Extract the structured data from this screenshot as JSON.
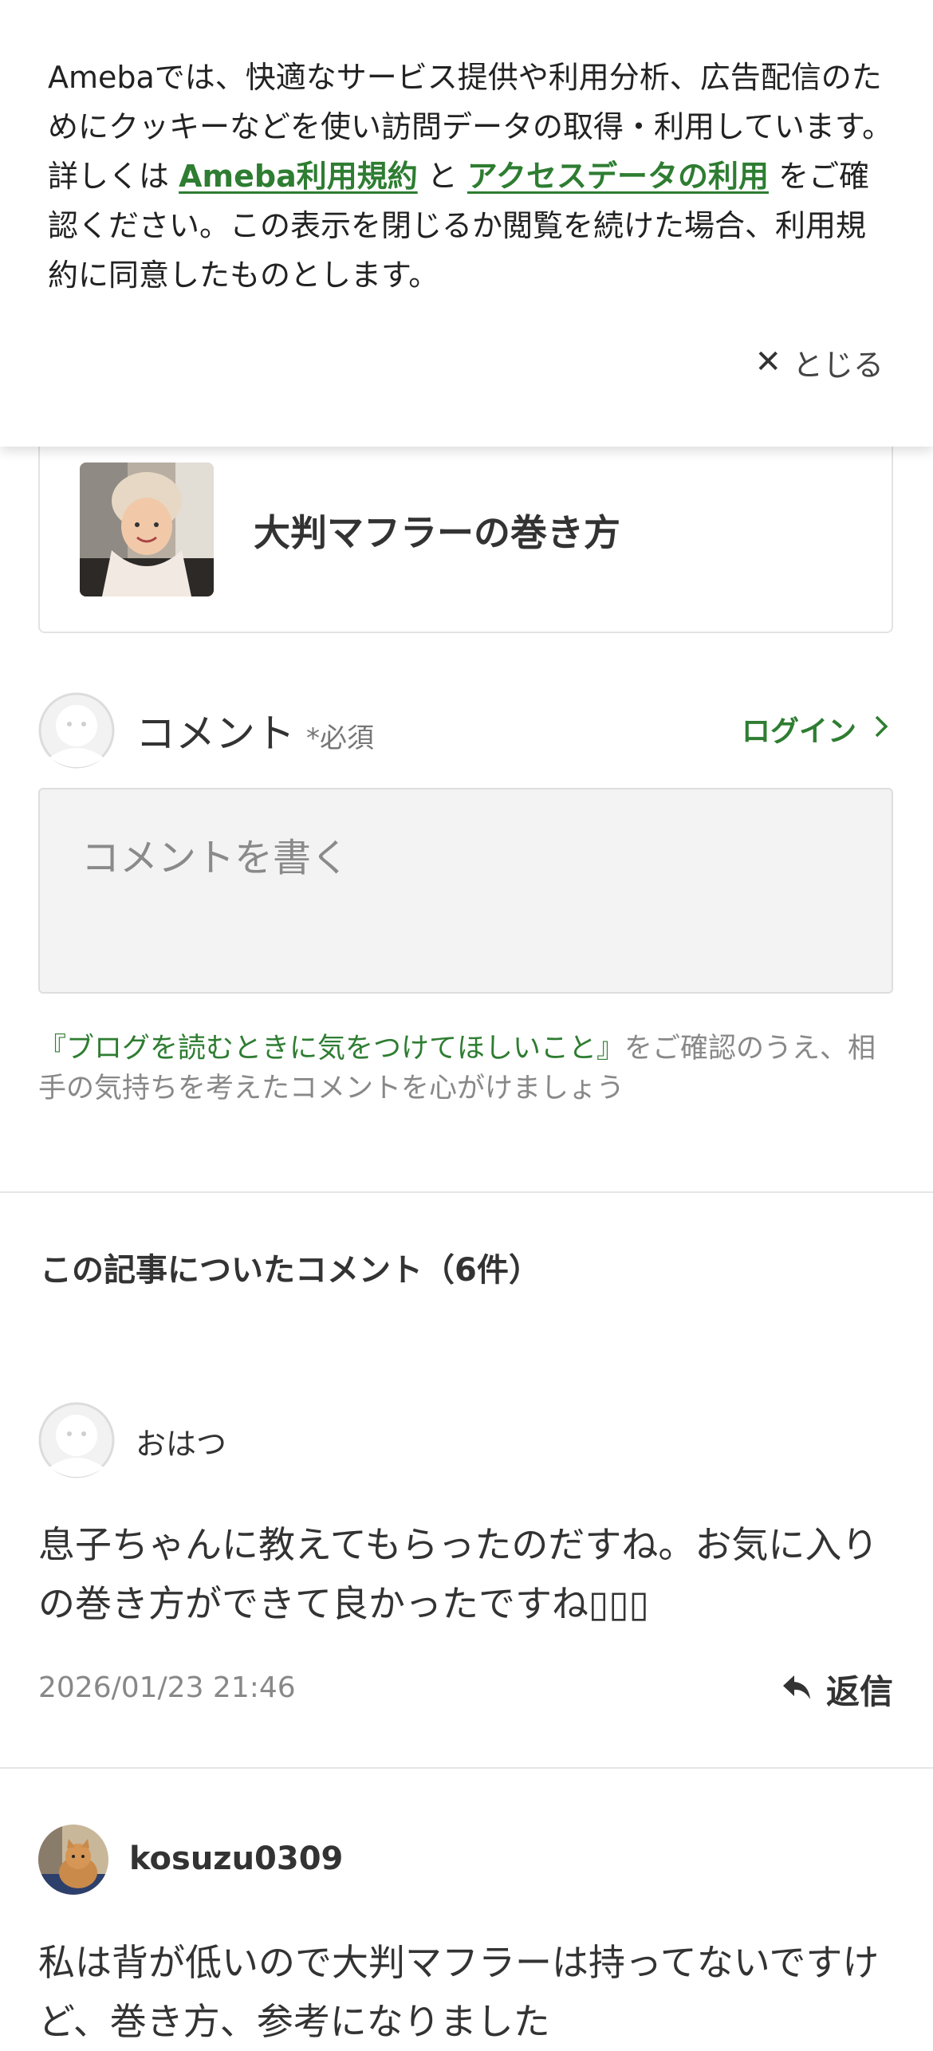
{
  "cookie_banner": {
    "text_before": "Amebaでは、快適なサービス提供や利用分析、広告配信のためにクッキーなどを使い訪問データの取得・利用しています。詳しくは ",
    "link_terms": "Ameba利用規約",
    "text_and": " と ",
    "link_access": "アクセスデータの利用",
    "text_after": " をご確認ください。この表示を閉じるか閲覧を続けた場合、利用規約に同意したものとします。",
    "close_label": "とじる"
  },
  "article": {
    "title": "大判マフラーの巻き方"
  },
  "comment_form": {
    "label": "コメント",
    "required": "*必須",
    "login_label": "ログイン",
    "placeholder": "コメントを書く",
    "guide_link": "『ブログを読むときに気をつけてほしいこと』",
    "guide_text": "をご確認のうえ、相手の気持ちを考えたコメントを心がけましょう"
  },
  "comments_section": {
    "title": "この記事についたコメント（6件）"
  },
  "comments": [
    {
      "author": "おはつ",
      "body": "息子ちゃんに教えてもらったのだすね。お気に入りの巻き方ができて良かったですね▯▯▯",
      "date": "2026/01/23 21:46",
      "reply_label": "返信"
    },
    {
      "author": "kosuzu0309",
      "body": "私は背が低いので大判マフラーは持ってないですけど、巻き方、参考になりました"
    }
  ],
  "colors": {
    "accent_green": "#2e7d32",
    "text": "#333333",
    "muted": "#888888"
  }
}
